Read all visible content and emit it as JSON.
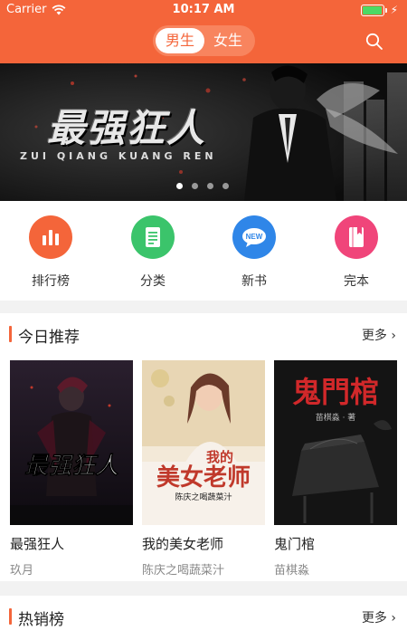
{
  "status": {
    "carrier": "Carrier",
    "time": "10:17 AM"
  },
  "nav": {
    "tab_male": "男生",
    "tab_female": "女生",
    "selected": "男生"
  },
  "banner": {
    "title": "最强狂人",
    "subtitle": "ZUI QIANG KUANG REN",
    "dot_count": 4,
    "active_dot": 1
  },
  "categories": [
    {
      "label": "排行榜",
      "icon": "bar-chart-icon",
      "color": "#f4653a"
    },
    {
      "label": "分类",
      "icon": "list-doc-icon",
      "color": "#3bc46b"
    },
    {
      "label": "新书",
      "icon": "new-badge-icon",
      "color": "#2f86e8",
      "badge": "NEW"
    },
    {
      "label": "完本",
      "icon": "book-icon",
      "color": "#f0457a"
    }
  ],
  "today": {
    "title": "今日推荐",
    "more": "更多",
    "books": [
      {
        "name": "最强狂人",
        "author": "玖月",
        "cover_text": "最强狂人"
      },
      {
        "name": "我的美女老师",
        "author": "陈庆之喝蔬菜汁",
        "cover_text_a": "我的",
        "cover_text_b": "美女老师",
        "cover_author": "陈庆之喝蔬菜汁"
      },
      {
        "name": "鬼门棺",
        "author": "苗棋淼",
        "cover_text": "鬼門棺",
        "cover_author": "苗棋淼 · 著"
      }
    ]
  },
  "hot": {
    "title": "热销榜",
    "more": "更多"
  }
}
